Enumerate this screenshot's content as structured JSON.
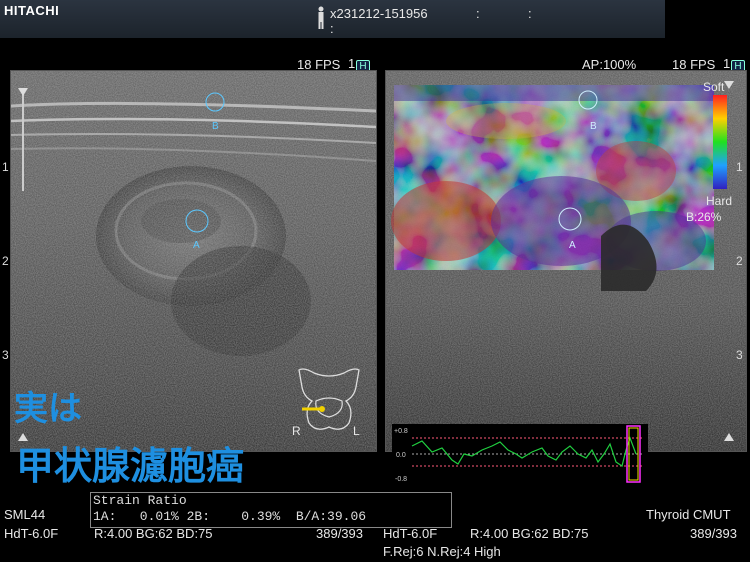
{
  "header": {
    "brand": "HITACHI",
    "patient_id": "x231212-151956",
    "colon_1": ":",
    "colon_2": ":",
    "colon_3": ":"
  },
  "left_panel": {
    "fps": "18 FPS",
    "frame_index": "1",
    "h_label": "H",
    "roi_a": "A",
    "roi_b": "B",
    "depth_ticks": [
      "1",
      "2",
      "3"
    ],
    "orientation_r": "R",
    "orientation_l": "L"
  },
  "right_panel": {
    "ap": "AP:100%",
    "fps": "18 FPS",
    "frame_index": "1",
    "h_label": "H",
    "scale_soft": "Soft",
    "scale_hard": "Hard",
    "scale_b": "B:26%",
    "roi_a": "A",
    "roi_b": "B",
    "depth_ticks": [
      "1",
      "2",
      "3"
    ],
    "strain_graph_labels": [
      "+0.8",
      "0.0",
      "-0.8"
    ]
  },
  "annotation": {
    "line1": "実は",
    "line2": "甲状腺濾胞癌"
  },
  "footer_left": {
    "probe": "SML44",
    "mode": "HdT-6.0F",
    "params": "R:4.00  BG:62  BD:75",
    "frames": "389/393"
  },
  "strain_ratio": {
    "title": "Strain Ratio",
    "line": "1A:   0.01% 2B:    0.39%  B/A:39.06"
  },
  "footer_right": {
    "mode": "HdT-6.0F",
    "params": "R:4.00  BG:62  BD:75",
    "rej": "F.Rej:6 N.Rej:4  High",
    "preset": "Thyroid CMUT",
    "frames": "389/393"
  },
  "colors": {
    "annotation": "#1e8fe0",
    "roi": "#5cc8ff",
    "strain_curve": "#20d040",
    "strain_limits": "#ff5a7a",
    "strain_marker": "#ff30ff"
  }
}
